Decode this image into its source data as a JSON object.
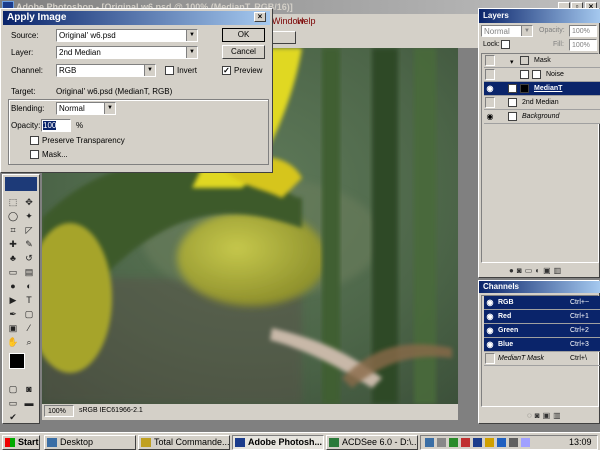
{
  "app": {
    "title": "Adobe Photoshop - [Original w6.psd @ 100% (MedianT, RGB/16)]"
  },
  "menu": {
    "items": [
      "Window",
      "Help"
    ]
  },
  "dialog": {
    "title": "Apply Image",
    "source_label": "Source:",
    "source_value": "Original' w6.psd",
    "layer_label": "Layer:",
    "layer_value": "2nd Median",
    "channel_label": "Channel:",
    "channel_value": "RGB",
    "invert_label": "Invert",
    "invert_checked": false,
    "target_label": "Target:",
    "target_value": "Original' w6.psd (MedianT, RGB)",
    "blending_label": "Blending:",
    "blending_value": "Normal",
    "opacity_label": "Opacity:",
    "opacity_value": "100",
    "opacity_unit": "%",
    "preserve_label": "Preserve Transparency",
    "preserve_checked": false,
    "mask_label": "Mask...",
    "mask_checked": false,
    "ok_label": "OK",
    "cancel_label": "Cancel",
    "preview_label": "Preview",
    "preview_checked": true
  },
  "layers": {
    "title": "Layers",
    "mode": "Normal",
    "opacity_label": "Opacity:",
    "opacity_value": "100%",
    "lock_label": "Lock:",
    "fill_label": "Fill:",
    "fill_value": "100%",
    "rows": [
      {
        "name": "Mask",
        "eye": false,
        "selected": false
      },
      {
        "name": "Noise",
        "eye": false,
        "selected": false
      },
      {
        "name": "MedianT",
        "eye": true,
        "selected": true
      },
      {
        "name": "2nd Median",
        "eye": false,
        "selected": false
      },
      {
        "name": "Background",
        "eye": true,
        "selected": false
      }
    ]
  },
  "channels": {
    "title": "Channels",
    "rows": [
      {
        "name": "RGB",
        "shortcut": "Ctrl+~",
        "selected": true
      },
      {
        "name": "Red",
        "shortcut": "Ctrl+1",
        "selected": true
      },
      {
        "name": "Green",
        "shortcut": "Ctrl+2",
        "selected": true
      },
      {
        "name": "Blue",
        "shortcut": "Ctrl+3",
        "selected": true
      },
      {
        "name": "MedianT Mask",
        "shortcut": "Ctrl+\\",
        "selected": false
      }
    ]
  },
  "status": {
    "zoom": "100%",
    "doc_info": "sRGB IEC61966-2.1"
  },
  "taskbar": {
    "start_label": "Start",
    "tasks": [
      "Desktop",
      "Total Commande...",
      "Adobe Photosh...",
      "ACDSee 6.0 - D:\\..."
    ],
    "clock": "13:09"
  }
}
